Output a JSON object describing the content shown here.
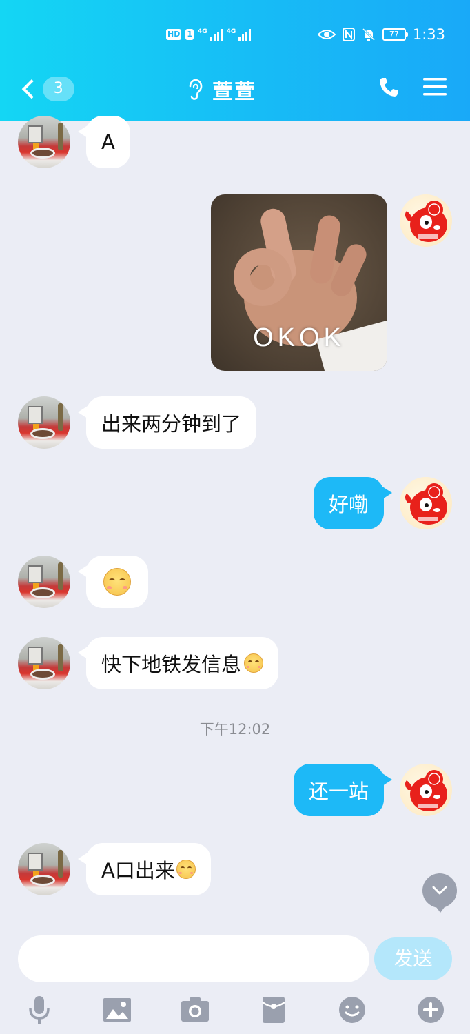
{
  "status_bar": {
    "left_badge": "HD",
    "sim_badge": "1",
    "network_1": "4G",
    "network_2": "4G",
    "battery": "77",
    "time": "1:33"
  },
  "header": {
    "unread_count": "3",
    "contact_name": "萱萱",
    "icons": [
      "back-icon",
      "ear-icon",
      "phone-icon",
      "menu-icon"
    ]
  },
  "messages": [
    {
      "from": "them",
      "text": "A"
    },
    {
      "from": "me",
      "image_caption": "OKOK"
    },
    {
      "from": "them",
      "text": "出来两分钟到了"
    },
    {
      "from": "me",
      "text": "好嘞"
    },
    {
      "from": "them",
      "emoji": "smiley"
    },
    {
      "from": "them",
      "text": "快下地铁发信息"
    },
    {
      "from": "me",
      "text": "还一站"
    },
    {
      "from": "them",
      "text": "A口出来"
    }
  ],
  "timestamp": "下午12:02",
  "composer": {
    "placeholder": "",
    "send_label": "发送"
  },
  "toolbar": [
    "mic-icon",
    "image-icon",
    "camera-icon",
    "red-packet-icon",
    "emoji-icon",
    "plus-icon"
  ],
  "colors": {
    "header_start": "#14d6f4",
    "header_end": "#19a9f8",
    "my_bubble": "#1db9f7",
    "their_bubble": "#ffffff",
    "background": "#ebedf5"
  }
}
